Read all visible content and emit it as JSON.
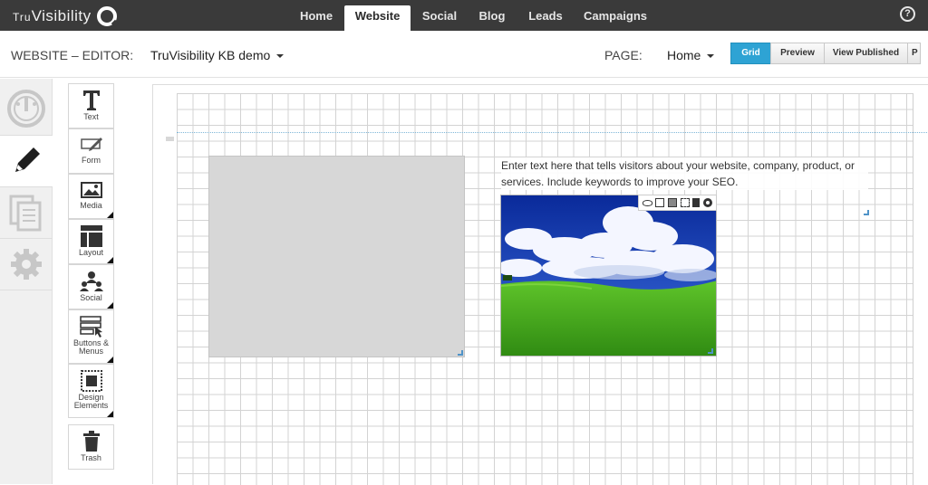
{
  "app": {
    "logo_small": "Tru",
    "logo_large": "Visibility"
  },
  "nav": {
    "items": [
      {
        "label": "Home"
      },
      {
        "label": "Website"
      },
      {
        "label": "Social"
      },
      {
        "label": "Blog"
      },
      {
        "label": "Leads"
      },
      {
        "label": "Campaigns"
      }
    ],
    "active": "Website",
    "help_icon": "?"
  },
  "subheader": {
    "editor_label": "WEBSITE – EDITOR:",
    "site_name": "TruVisibility KB demo",
    "page_label": "PAGE:",
    "page_name": "Home",
    "buttons": [
      {
        "label": "Grid"
      },
      {
        "label": "Preview"
      },
      {
        "label": "View Published"
      },
      {
        "label": "P"
      }
    ],
    "active_button": "Grid"
  },
  "sidebar": {
    "items": [
      {
        "icon": "dashboard-icon"
      },
      {
        "icon": "pencil-icon"
      },
      {
        "icon": "pages-icon"
      },
      {
        "icon": "gear-icon"
      }
    ],
    "active": "pencil-icon"
  },
  "tools": [
    {
      "label": "Text",
      "icon": "text-icon"
    },
    {
      "label": "Form",
      "icon": "form-icon"
    },
    {
      "label": "Media",
      "icon": "media-icon"
    },
    {
      "label": "Layout",
      "icon": "layout-icon"
    },
    {
      "label": "Social",
      "icon": "social-icon"
    },
    {
      "label": "Buttons &",
      "label2": "Menus",
      "icon": "buttons-menus-icon"
    },
    {
      "label": "Design",
      "label2": "Elements",
      "icon": "design-elements-icon"
    },
    {
      "label": "Trash",
      "icon": "trash-icon"
    }
  ],
  "canvas": {
    "text_block": "Enter text here that tells visitors about your website, company, product, or services. Include keywords to improve your SEO."
  },
  "colors": {
    "topbar": "#3a3a3a",
    "accent": "#2ea3d4"
  }
}
